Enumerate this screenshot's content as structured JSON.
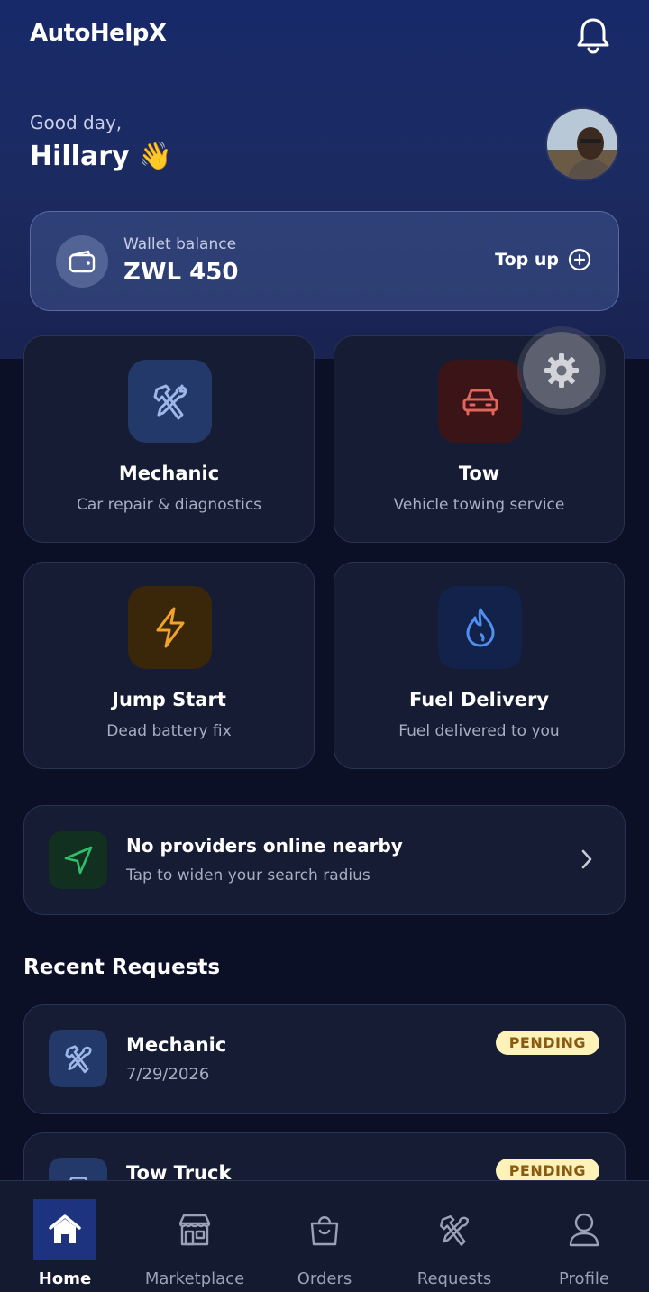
{
  "header": {
    "app_title": "AutoHelpX",
    "greeting": "Good day,",
    "user_name": "Hillary",
    "wave_emoji": "👋"
  },
  "wallet": {
    "label": "Wallet balance",
    "amount": "ZWL 450",
    "topup_label": "Top up"
  },
  "services": [
    {
      "title": "Mechanic",
      "subtitle": "Car repair & diagnostics",
      "icon": "wrench-hammer-icon",
      "tile_color": "#22396a",
      "icon_color": "#9fb6e8"
    },
    {
      "title": "Tow",
      "subtitle": "Vehicle towing service",
      "icon": "car-icon",
      "tile_color": "#3b1418",
      "icon_color": "#e2675a"
    },
    {
      "title": "Jump Start",
      "subtitle": "Dead battery fix",
      "icon": "lightning-icon",
      "tile_color": "#3a2608",
      "icon_color": "#f0a32a"
    },
    {
      "title": "Fuel Delivery",
      "subtitle": "Fuel delivered to you",
      "icon": "flame-icon",
      "tile_color": "#13224a",
      "icon_color": "#4f8ff0"
    }
  ],
  "nearby": {
    "title": "No providers online nearby",
    "subtitle": "Tap to widen your search radius"
  },
  "recent": {
    "title": "Recent Requests",
    "items": [
      {
        "title": "Mechanic",
        "date": "7/29/2026",
        "status": "PENDING"
      },
      {
        "title": "Tow Truck",
        "date": "",
        "status": "PENDING"
      }
    ]
  },
  "nav": [
    {
      "label": "Home",
      "icon": "home-icon",
      "active": true
    },
    {
      "label": "Marketplace",
      "icon": "store-icon",
      "active": false
    },
    {
      "label": "Orders",
      "icon": "shopping-bag-icon",
      "active": false
    },
    {
      "label": "Requests",
      "icon": "tools-icon",
      "active": false
    },
    {
      "label": "Profile",
      "icon": "user-icon",
      "active": false
    }
  ],
  "colors": {
    "accent": "#1d3380",
    "badge_bg": "#fdf2b8",
    "badge_text": "#8a5a12"
  }
}
